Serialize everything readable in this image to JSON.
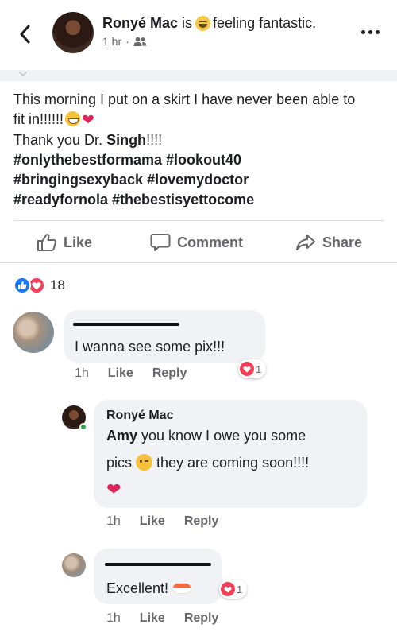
{
  "header": {
    "author": "Ronyé Mac",
    "is_text": "is",
    "feeling_text": "feeling fantastic.",
    "time": "1 hr",
    "dot": "·"
  },
  "post": {
    "line1": "This morning I put on a skirt I have never been able to",
    "line2_text": "fit in!!!!!!",
    "line3_pre": "Thank you Dr. ",
    "line3_bold": "Singh",
    "line3_post": "!!!!",
    "line4": "#onlythebestformama #lookout40",
    "line5": "#bringingsexyback #lovemydoctor",
    "line6": "#readyfornola #thebestisyettocome"
  },
  "actions": {
    "like": "Like",
    "comment": "Comment",
    "share": "Share"
  },
  "reactions": {
    "count": "18"
  },
  "comments": [
    {
      "text": "I wanna see some pix!!!",
      "time": "1h",
      "like": "Like",
      "reply": "Reply",
      "reaction_count": "1"
    },
    {
      "author": "Ronyé Mac",
      "mention": "Amy",
      "text_a": " you know I owe you some",
      "text_b_pre": "pics ",
      "text_b_post": " they are coming soon!!!!",
      "time": "1h",
      "like": "Like",
      "reply": "Reply"
    },
    {
      "text": "Excellent! ",
      "time": "1h",
      "like": "Like",
      "reply": "Reply",
      "reaction_count": "1"
    }
  ],
  "icons": {
    "back": "chevron-left-icon",
    "more": "more-horizontal-icon",
    "audience": "friends-icon",
    "like": "thumbs-up-icon",
    "comment": "speech-bubble-icon",
    "share": "share-arrow-icon"
  },
  "colors": {
    "facebook_blue": "#1877f2",
    "love_red": "#f33e58",
    "muted_text": "#65676b",
    "bubble_bg": "#f0f2f5"
  }
}
